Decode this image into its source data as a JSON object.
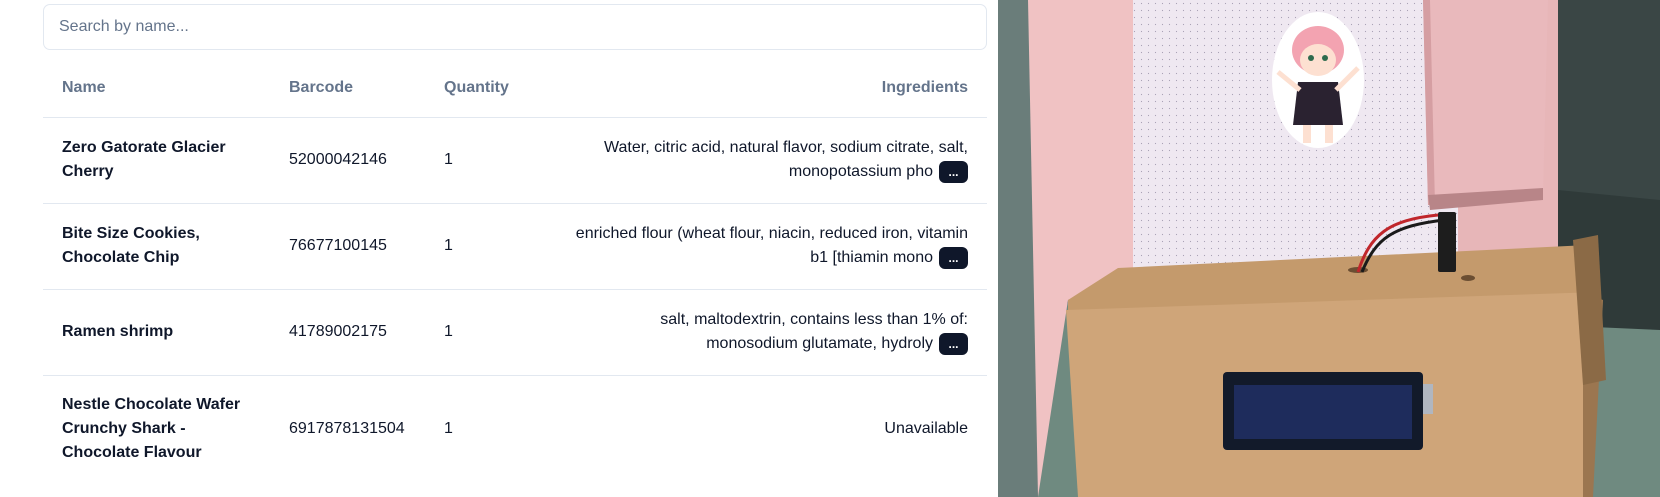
{
  "search": {
    "placeholder": "Search by name..."
  },
  "table": {
    "columns": [
      "Name",
      "Barcode",
      "Quantity",
      "Ingredients"
    ],
    "more_button_label": "...",
    "rows": [
      {
        "name": "Zero Gatorate Glacier Cherry",
        "barcode": "52000042146",
        "quantity": "1",
        "ingredients": "Water, citric acid, natural flavor, sodium citrate, salt, monopotassium pho",
        "truncated": true
      },
      {
        "name": "Bite Size Cookies, Chocolate Chip",
        "barcode": "76677100145",
        "quantity": "1",
        "ingredients": "enriched flour (wheat flour, niacin, reduced iron, vitamin b1 [thiamin mono",
        "truncated": true
      },
      {
        "name": "Ramen shrimp",
        "barcode": "41789002175",
        "quantity": "1",
        "ingredients": "salt, maltodextrin, contains less than 1% of: monosodium glutamate, hydroly",
        "truncated": true
      },
      {
        "name": "Nestle Chocolate Wafer Crunchy Shark - Chocolate Flavour",
        "barcode": "6917878131504",
        "quantity": "1",
        "ingredients": "Unavailable",
        "truncated": false
      }
    ]
  },
  "colors": {
    "header_text": "#64748b",
    "body_text": "#0f172a",
    "border": "#e2e8f0",
    "button_bg": "#0f172a"
  },
  "photo": {
    "icons": [
      "anime-sticker-icon",
      "lcd-display-icon",
      "cardboard-box-icon",
      "wire-icon"
    ]
  }
}
